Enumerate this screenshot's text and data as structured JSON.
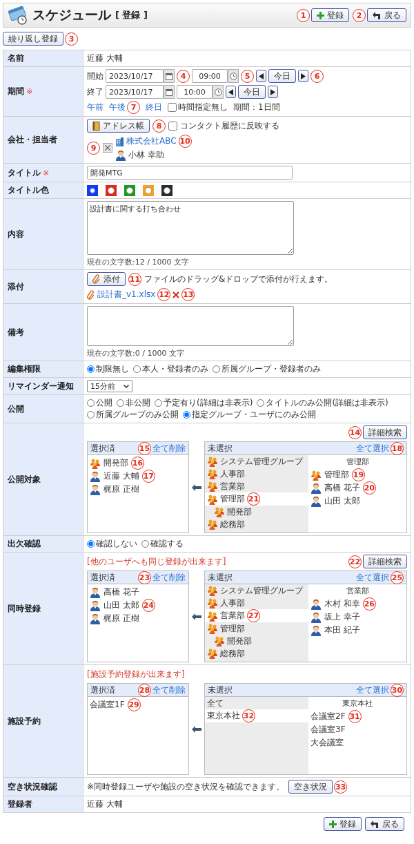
{
  "header": {
    "title": "スケジュール",
    "subtitle": "[ 登録 ]",
    "buttons": [
      {
        "kind": "add",
        "label": "登録",
        "callout": "1"
      },
      {
        "kind": "back",
        "label": "戻る",
        "callout": "2"
      }
    ]
  },
  "repeat_button": {
    "label": "繰り返し登録",
    "callout": "3"
  },
  "name_row": {
    "label": "名前",
    "value": "近藤 大輔"
  },
  "period": {
    "label": "期間",
    "required_mark": "※",
    "rows": [
      {
        "label": "開始",
        "date": "2023/10/17",
        "time": "09:00",
        "today": "今日",
        "calendar_callout": "4",
        "clock_callout": "5",
        "today_callout": "6"
      },
      {
        "label": "終了",
        "date": "2023/10/17",
        "time": "10:00",
        "today": "今日"
      }
    ],
    "quick_links": [
      {
        "label": "午前"
      },
      {
        "label": "午後",
        "callout": "7"
      },
      {
        "label": "終日"
      }
    ],
    "no_time": {
      "label": "時間指定無し",
      "checked": false
    },
    "duration": "期間：1日間"
  },
  "company": {
    "label": "会社・担当者",
    "address_button": {
      "label": "アドレス帳",
      "callout": "8"
    },
    "contact_history": {
      "label": "コンタクト履歴に反映する",
      "checked": false
    },
    "remove_callout": "9",
    "company_link": "株式会社ABC",
    "company_callout": "10",
    "person": "小林 幸助"
  },
  "title": {
    "label": "タイトル",
    "required_mark": "※",
    "value": "開発MTG"
  },
  "title_color": {
    "label": "タイトル色",
    "options": [
      {
        "color": "#1437f0",
        "selected": true
      },
      {
        "color": "#e3261b",
        "selected": false
      },
      {
        "color": "#1c9a22",
        "selected": false
      },
      {
        "color": "#f5a01e",
        "selected": false
      },
      {
        "color": "#2b2b2b",
        "selected": false
      }
    ]
  },
  "content": {
    "label": "内容",
    "value": "設計書に関する打ち合わせ",
    "counter": "現在の文字数:12 / 1000 文字"
  },
  "attachment": {
    "label": "添付",
    "button": {
      "label": "添付",
      "callout": "11"
    },
    "hint": "ファイルのドラッグ&ドロップで添付が行えます。",
    "files": [
      {
        "name": "設計書_v1.xlsx",
        "callout": "12",
        "delete_callout": "13"
      }
    ]
  },
  "remarks": {
    "label": "備考",
    "counter": "現在の文字数:0 / 1000 文字"
  },
  "edit_permission": {
    "label": "編集権限",
    "options": [
      {
        "label": "制限無し",
        "selected": true
      },
      {
        "label": "本人・登録者のみ",
        "selected": false
      },
      {
        "label": "所属グループ・登録者のみ",
        "selected": false
      }
    ]
  },
  "reminder": {
    "label": "リマインダー通知",
    "value": "15分前"
  },
  "visibility": {
    "label": "公開",
    "options": [
      {
        "label": "公開",
        "selected": false
      },
      {
        "label": "非公開",
        "selected": false
      },
      {
        "label": "予定有り(詳細は非表示)",
        "selected": false
      },
      {
        "label": "タイトルのみ公開(詳細は非表示)",
        "selected": false
      },
      {
        "label": "所属グループのみ公開",
        "selected": false
      },
      {
        "label": "指定グループ・ユーザにのみ公開",
        "selected": true
      }
    ]
  },
  "public_targets": {
    "label": "公開対象",
    "search_button": {
      "label": "詳細検索",
      "callout": "14"
    },
    "selected_title": "選択済",
    "remove_all": {
      "label": "全て削除",
      "callout": "15"
    },
    "selected_items": [
      {
        "kind": "group",
        "name": "開発部",
        "callout": "16"
      },
      {
        "kind": "user",
        "name": "近藤 大輔",
        "callout": "17"
      },
      {
        "kind": "user",
        "name": "梶原 正樹"
      }
    ],
    "unselected_title": "未選択",
    "select_all": {
      "label": "全て選択",
      "callout": "18"
    },
    "groups": [
      {
        "kind": "group",
        "name": "システム管理グループ",
        "selected": false
      },
      {
        "kind": "group",
        "name": "人事部",
        "selected": false
      },
      {
        "kind": "group",
        "name": "営業部",
        "selected": false
      },
      {
        "kind": "group",
        "name": "管理部",
        "selected": true,
        "callout": "21",
        "children": [
          {
            "kind": "group",
            "name": "開発部",
            "selected": false
          }
        ]
      },
      {
        "kind": "group",
        "name": "総務部",
        "selected": false
      }
    ],
    "member_heading": "管理部",
    "members": [
      {
        "kind": "group",
        "name": "管理部",
        "callout": "19"
      },
      {
        "kind": "user",
        "name": "高橋 花子",
        "callout": "20"
      },
      {
        "kind": "user",
        "name": "山田 太郎"
      }
    ]
  },
  "attendance": {
    "label": "出欠確認",
    "options": [
      {
        "label": "確認しない",
        "selected": true
      },
      {
        "label": "確認する",
        "selected": false
      }
    ]
  },
  "simultaneous": {
    "label": "同時登録",
    "note": "[他のユーザへも同じ登録が出来ます]",
    "search_button": {
      "label": "詳細検索",
      "callout": "22"
    },
    "selected_title": "選択済",
    "remove_all": {
      "label": "全て削除",
      "callout": "23"
    },
    "selected_items": [
      {
        "kind": "user",
        "name": "高橋 花子"
      },
      {
        "kind": "user",
        "name": "山田 太郎",
        "callout": "24"
      },
      {
        "kind": "user",
        "name": "梶原 正樹"
      }
    ],
    "unselected_title": "未選択",
    "select_all": {
      "label": "全て選択",
      "callout": "25"
    },
    "groups": [
      {
        "kind": "group",
        "name": "システム管理グループ",
        "selected": false
      },
      {
        "kind": "group",
        "name": "人事部",
        "selected": false
      },
      {
        "kind": "group",
        "name": "営業部",
        "selected": true,
        "callout": "27"
      },
      {
        "kind": "group",
        "name": "管理部",
        "selected": false,
        "children": [
          {
            "kind": "group",
            "name": "開発部",
            "selected": false
          }
        ]
      },
      {
        "kind": "group",
        "name": "総務部",
        "selected": false
      }
    ],
    "member_heading": "営業部",
    "members": [
      {
        "kind": "user",
        "name": "木村 和幸",
        "callout": "26"
      },
      {
        "kind": "user",
        "name": "坂上 幸子"
      },
      {
        "kind": "user",
        "name": "本田 紀子"
      }
    ]
  },
  "facility": {
    "label": "施設予約",
    "note": "[施設予約登録が出来ます]",
    "selected_title": "選択済",
    "remove_all": {
      "label": "全て削除",
      "callout": "28"
    },
    "selected_items": [
      {
        "name": "会議室1F",
        "callout": "29"
      }
    ],
    "unselected_title": "未選択",
    "select_all": {
      "label": "全て選択",
      "callout": "30"
    },
    "groups": [
      {
        "name": "全て",
        "selected": false
      },
      {
        "name": "東京本社",
        "selected": true,
        "callout": "32"
      }
    ],
    "member_heading": "東京本社",
    "members": [
      {
        "name": "会議室2F",
        "callout": "31"
      },
      {
        "name": "会議室3F"
      },
      {
        "name": "大会議室"
      }
    ]
  },
  "availability": {
    "label": "空き状況確認",
    "note": "※同時登録ユーザや施設の空き状況を確認できます。",
    "button": {
      "label": "空き状況",
      "callout": "33"
    }
  },
  "registrant": {
    "label": "登録者",
    "value": "近藤 大輔"
  },
  "footer_buttons": [
    {
      "kind": "add",
      "label": "登録"
    },
    {
      "kind": "back",
      "label": "戻る"
    }
  ]
}
